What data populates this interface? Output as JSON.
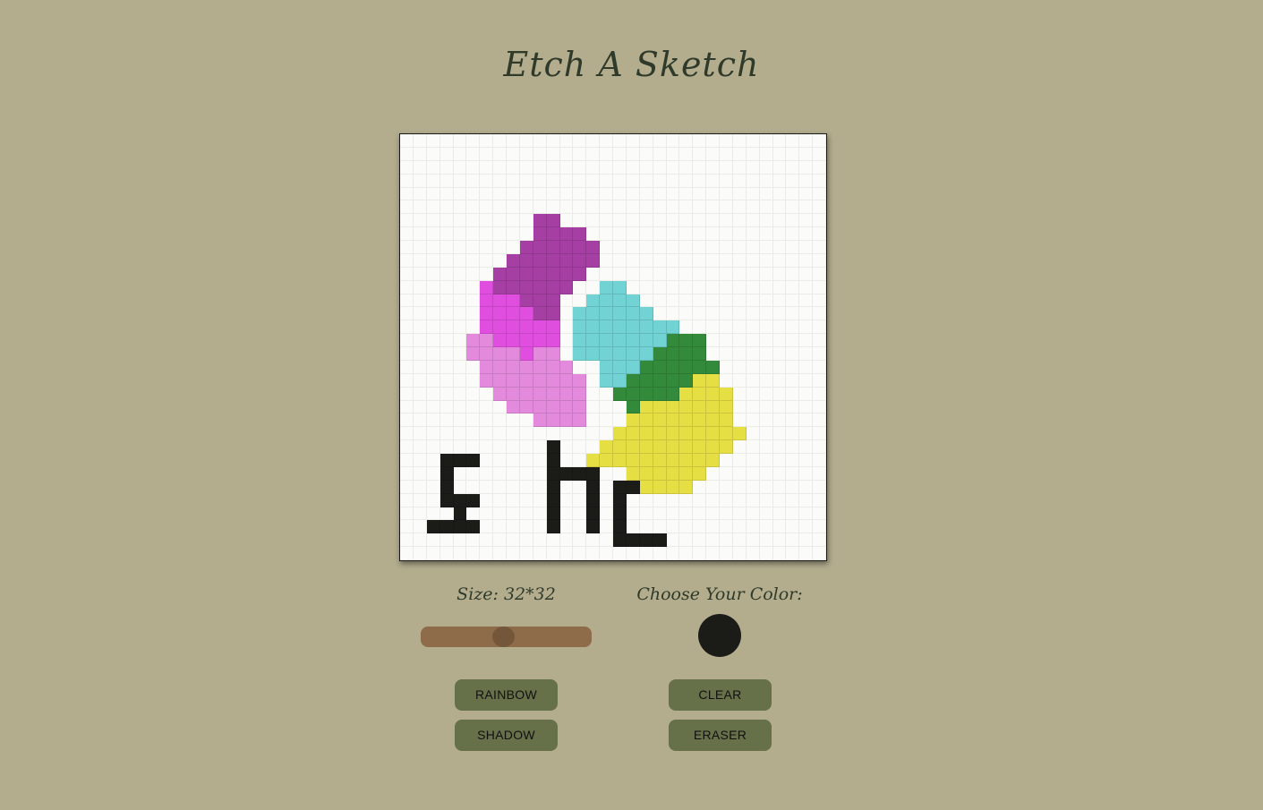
{
  "title": "Etch A Sketch",
  "size_label": "Size: 32*32",
  "color_label": "Choose Your Color:",
  "grid_size": 32,
  "slider_value_fraction": 0.48,
  "selected_color": "#1b1b18",
  "buttons": {
    "rainbow": "RAINBOW",
    "shadow": "SHADOW",
    "clear": "CLEAR",
    "eraser": "ERASER"
  },
  "palette": {
    "P": "#a63fa4",
    "M": "#e04ee0",
    "L": "#e38add",
    "C": "#71d3d4",
    "G": "#338a3b",
    "Y": "#e6df44",
    "K": "#1b1b18"
  },
  "drawing": [
    "................................",
    "................................",
    "................................",
    "................................",
    "................................",
    "................................",
    "..........PP....................",
    "..........PPPP..................",
    ".........PPPPPP.................",
    "........PPPPPPP.................",
    ".......PPPPPPP..................",
    "......MPPPPPP..CC...............",
    "......MMMPPP..CCCC..............",
    "......MMMMPP.CCCCCC.............",
    "......MMMMMM.CCCCCCCC...........",
    ".....LLMMMMM.CCCCCCCGGG.........",
    ".....LLLLMLL.CCCCCCGGGG.........",
    "......LLLLLLL..CCCGGGGGG........",
    "......LLLLLLLL.CCGGGGGYY........",
    ".......LLLLLLL..GGGGGYYYY.......",
    "........LLLLLL...GYYYYYYY.......",
    "..........LLLL...YYYYYYYY.......",
    "................YYYYYYYYYY......",
    "...........K...YYYYYYYYYY.......",
    "...KKK.....K..YYYYYYYYYY........",
    "...K.......KKKK..YYYYYY.........",
    "...K.......K..K.KKYYYY..........",
    "...KKK.....K..K.K...............",
    "....K......K..K.K...............",
    "..KKKK.....K..K.K...............",
    "................KKKK............",
    "................................"
  ]
}
